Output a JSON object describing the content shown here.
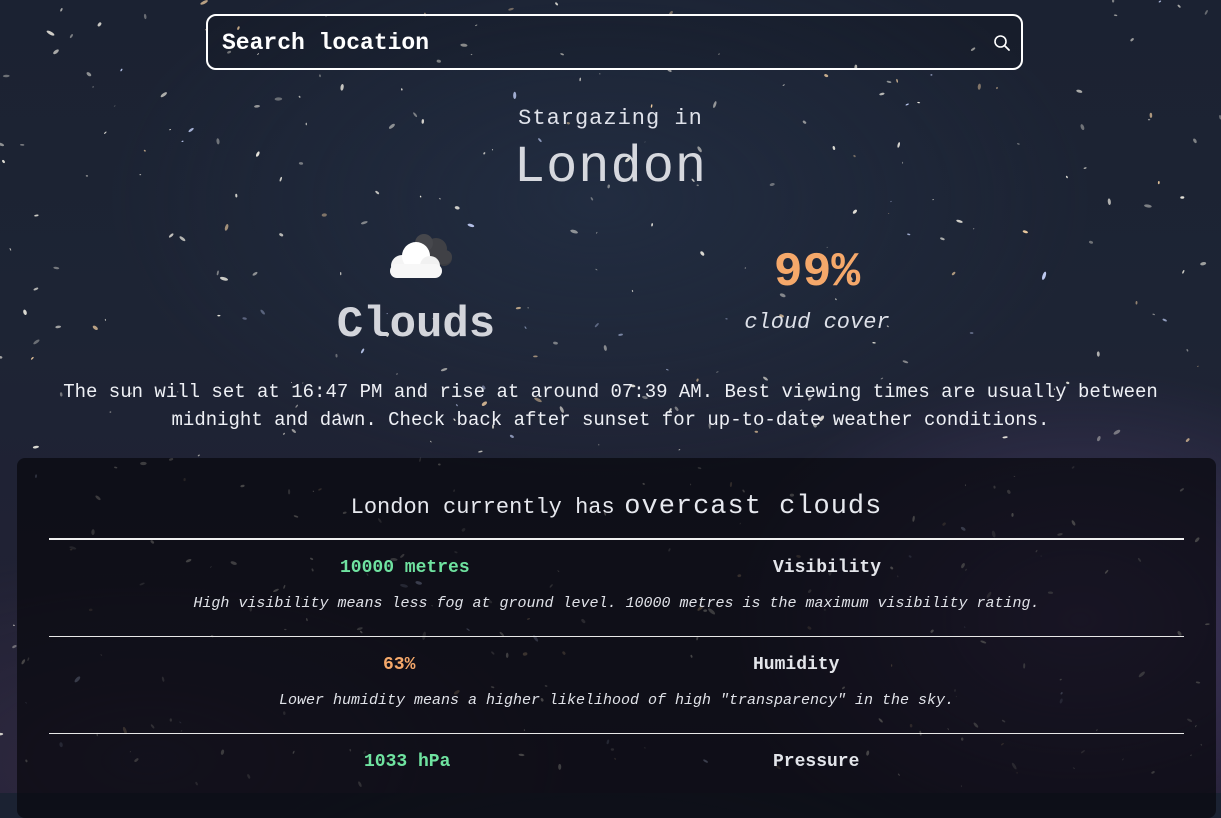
{
  "search": {
    "placeholder": "Search location",
    "icon": "search-icon"
  },
  "header": {
    "subtitle": "Stargazing in",
    "city": "London"
  },
  "current": {
    "icon": "cloud-icon",
    "condition": "Clouds",
    "cloud_cover_value": "99%",
    "cloud_cover_label": "cloud cover"
  },
  "sun_info": "The sun will set at 16:47 PM and rise at around 07:39 AM. Best viewing times are usually between midnight and dawn. Check back after sunset for up-to-date weather conditions.",
  "details": {
    "heading_lead": "London currently has",
    "heading_condition": "overcast clouds",
    "rows": [
      {
        "value": "10000 metres",
        "value_color": "#6fe3a0",
        "label": "Visibility",
        "note": "High visibility means less fog at ground level. 10000 metres is the maximum visibility rating."
      },
      {
        "value": "63%",
        "value_color": "#f5a86a",
        "label": "Humidity",
        "note": "Lower humidity means a higher likelihood of high \"transparency\" in the sky."
      },
      {
        "value": "1033 hPa",
        "value_color": "#6fe3a0",
        "label": "Pressure",
        "note": ""
      }
    ]
  },
  "colors": {
    "accent_orange": "#f5a86a",
    "accent_green": "#6fe3a0"
  }
}
